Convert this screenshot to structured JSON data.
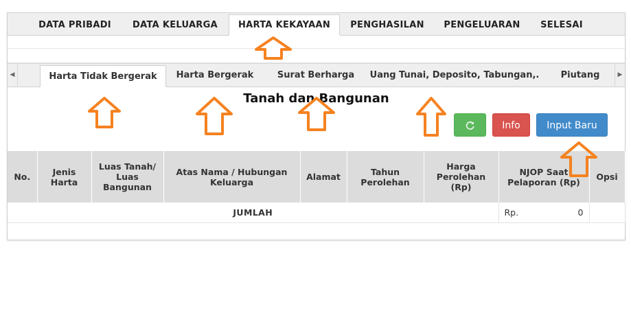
{
  "main_tabs": [
    {
      "label": "DATA PRIBADI"
    },
    {
      "label": "DATA KELUARGA"
    },
    {
      "label": "HARTA KEKAYAAN"
    },
    {
      "label": "PENGHASILAN"
    },
    {
      "label": "PENGELUARAN"
    },
    {
      "label": "SELESAI"
    }
  ],
  "sub_tabs": [
    {
      "label": "Harta Tidak Bergerak"
    },
    {
      "label": "Harta Bergerak"
    },
    {
      "label": "Surat Berharga"
    },
    {
      "label": "Uang Tunai, Deposito, Tabungan,."
    },
    {
      "label": "Piutang"
    }
  ],
  "section": {
    "title": "Tanah dan Bangunan"
  },
  "buttons": {
    "info": "Info",
    "input_baru": "Input Baru",
    "refresh_icon": "refresh-icon"
  },
  "table": {
    "headers": [
      {
        "label": "No."
      },
      {
        "label": "Jenis Harta"
      },
      {
        "label": "Luas Tanah/ Luas Bangunan"
      },
      {
        "label": "Atas Nama / Hubungan Keluarga"
      },
      {
        "label": "Alamat"
      },
      {
        "label": "Tahun Perolehan"
      },
      {
        "label": "Harga Perolehan (Rp)"
      },
      {
        "label": "NJOP Saat Pelaporan (Rp)"
      },
      {
        "label": "Opsi"
      }
    ],
    "footer": {
      "label": "JUMLAH",
      "currency": "Rp.",
      "total": "0"
    }
  },
  "colors": {
    "arrow": "#f58220",
    "green": "#5cb85c",
    "red": "#d9534f",
    "blue": "#428bca"
  }
}
